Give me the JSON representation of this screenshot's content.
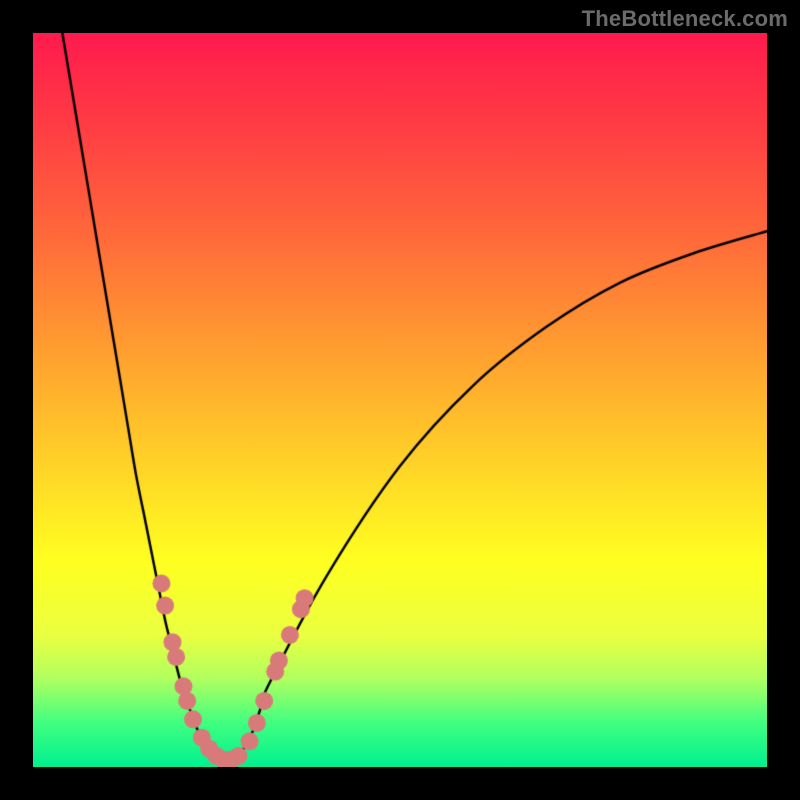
{
  "attribution": "TheBottleneck.com",
  "chart_data": {
    "type": "line",
    "title": "",
    "xlabel": "",
    "ylabel": "",
    "xlim": [
      0,
      100
    ],
    "ylim": [
      0,
      100
    ],
    "curve": {
      "name": "bottleneck-curve",
      "color": "#000000",
      "x": [
        4,
        5,
        6,
        7,
        8,
        9,
        10,
        11,
        12,
        13,
        14,
        15,
        16,
        17,
        18,
        19,
        20,
        21,
        22,
        23,
        24,
        25,
        26,
        27,
        28,
        29,
        30,
        31,
        32,
        40,
        50,
        60,
        70,
        80,
        90,
        100
      ],
      "y": [
        100,
        94,
        88,
        82,
        76,
        70,
        64,
        58,
        52,
        46,
        40,
        35,
        30,
        25,
        20,
        16,
        12,
        9,
        6,
        4,
        2.5,
        1.5,
        1,
        1,
        1.5,
        3,
        5,
        8,
        11,
        26,
        41,
        52,
        60,
        66,
        70,
        73
      ]
    },
    "scatter": {
      "name": "sample-points",
      "color": "#d97a7a",
      "points": [
        {
          "x": 17.5,
          "y": 25
        },
        {
          "x": 18.0,
          "y": 22
        },
        {
          "x": 19.0,
          "y": 17
        },
        {
          "x": 19.5,
          "y": 15
        },
        {
          "x": 20.5,
          "y": 11
        },
        {
          "x": 21.0,
          "y": 9
        },
        {
          "x": 21.8,
          "y": 6.5
        },
        {
          "x": 23.0,
          "y": 4
        },
        {
          "x": 24.0,
          "y": 2.5
        },
        {
          "x": 25.0,
          "y": 1.5
        },
        {
          "x": 26.0,
          "y": 1
        },
        {
          "x": 27.0,
          "y": 1
        },
        {
          "x": 28.0,
          "y": 1.5
        },
        {
          "x": 29.5,
          "y": 3.5
        },
        {
          "x": 30.5,
          "y": 6
        },
        {
          "x": 31.5,
          "y": 9
        },
        {
          "x": 33.0,
          "y": 13
        },
        {
          "x": 33.5,
          "y": 14.5
        },
        {
          "x": 35.0,
          "y": 18
        },
        {
          "x": 36.5,
          "y": 21.5
        },
        {
          "x": 37.0,
          "y": 23
        }
      ]
    }
  }
}
